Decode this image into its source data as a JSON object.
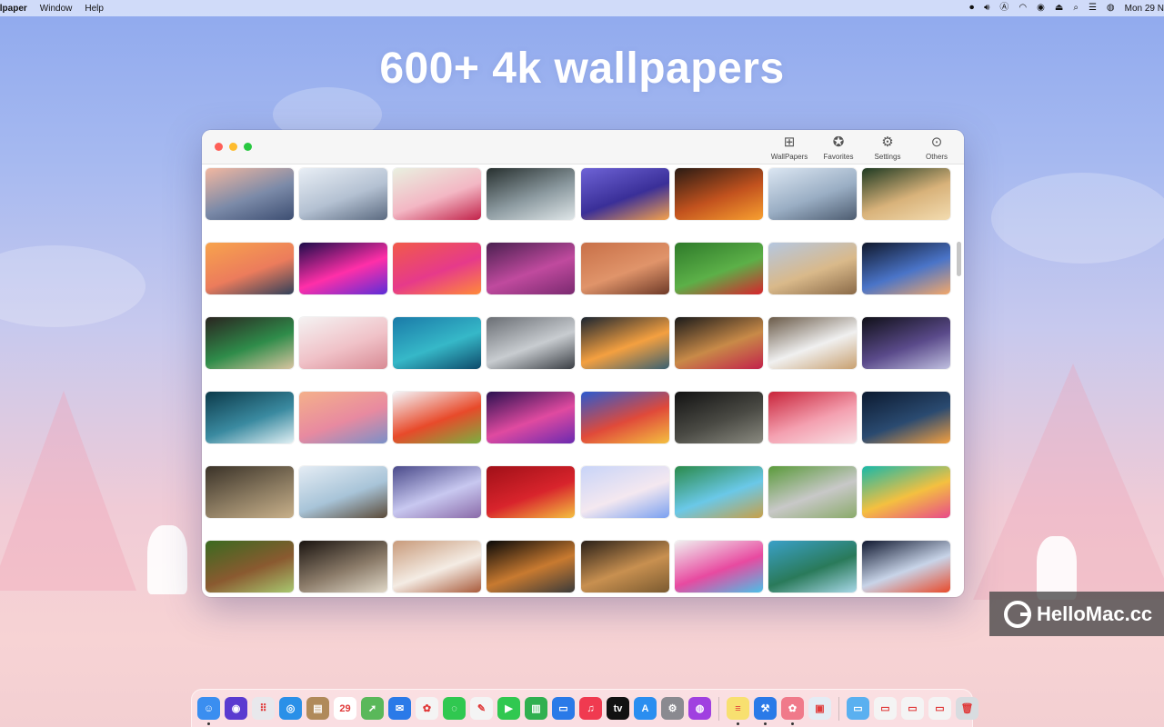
{
  "menubar": {
    "app_name": "llpaper",
    "items": [
      "Window",
      "Help"
    ],
    "clock": "Mon 29 N",
    "status_icons": [
      "record-icon",
      "volume-icon",
      "input-source-icon",
      "wifi-icon",
      "user-icon",
      "eject-icon",
      "spotlight-icon",
      "control-center-icon",
      "siri-icon"
    ]
  },
  "headline": "600+ 4k wallpapers",
  "window": {
    "toolbar": [
      {
        "name": "wallpapers",
        "label": "WallPapers",
        "icon": "grid-icon",
        "glyph": "⊞"
      },
      {
        "name": "favorites",
        "label": "Favorites",
        "icon": "star-icon",
        "glyph": "✪"
      },
      {
        "name": "settings",
        "label": "Settings",
        "icon": "gear-icon",
        "glyph": "⚙"
      },
      {
        "name": "others",
        "label": "Others",
        "icon": "ellipsis-icon",
        "glyph": "⊙"
      }
    ],
    "thumbnails": [
      {
        "name": "canyon-sunset",
        "colors": [
          "#f2b7a0",
          "#7b8aa8",
          "#3d4e72"
        ]
      },
      {
        "name": "snowy-mountain-climbers",
        "colors": [
          "#e8eef5",
          "#b4c1d2",
          "#5b6a80"
        ]
      },
      {
        "name": "raspberries-bowl",
        "colors": [
          "#e9f0e0",
          "#f3b7c4",
          "#c2224a"
        ]
      },
      {
        "name": "misty-forest-lake",
        "colors": [
          "#27302f",
          "#8c9aa0",
          "#dfe6e8"
        ]
      },
      {
        "name": "overwater-bungalows-dusk",
        "colors": [
          "#6e63d6",
          "#3a2f98",
          "#f6a24c"
        ]
      },
      {
        "name": "lava-waterfall",
        "colors": [
          "#2a1b14",
          "#c2521e",
          "#f8a030"
        ]
      },
      {
        "name": "car-snowy-road",
        "colors": [
          "#dbe6f2",
          "#9aaec4",
          "#4d5c70"
        ]
      },
      {
        "name": "golden-retriever",
        "colors": [
          "#1e3a22",
          "#d8b27a",
          "#f3dcb0"
        ]
      },
      {
        "name": "sunset-horizon",
        "colors": [
          "#f7a34d",
          "#ec7c5c",
          "#30405a"
        ]
      },
      {
        "name": "neon-pyramids",
        "colors": [
          "#1c0c4a",
          "#ff2fa8",
          "#5a2dd8"
        ]
      },
      {
        "name": "macos-big-sur",
        "colors": [
          "#f15a4a",
          "#e63a8a",
          "#ff8a3a"
        ]
      },
      {
        "name": "purple-blossoms",
        "colors": [
          "#4a2050",
          "#c04a9e",
          "#7a2a70"
        ]
      },
      {
        "name": "eggs-pattern",
        "colors": [
          "#c87048",
          "#e0946a",
          "#6e3a28"
        ]
      },
      {
        "name": "strawberries-leaves",
        "colors": [
          "#2e7a2a",
          "#5cb048",
          "#d8242c"
        ]
      },
      {
        "name": "desert-hills",
        "colors": [
          "#b5c7e0",
          "#d9b98a",
          "#8a6a48"
        ]
      },
      {
        "name": "lotus-flower",
        "colors": [
          "#10182c",
          "#4a74c8",
          "#f4a86a"
        ]
      },
      {
        "name": "coffee-cup",
        "colors": [
          "#2a2420",
          "#2f8c4a",
          "#d8c4a0"
        ]
      },
      {
        "name": "pink-coral",
        "colors": [
          "#f4f2f2",
          "#f0c2c8",
          "#d88a94"
        ]
      },
      {
        "name": "aerial-lagoon",
        "colors": [
          "#1a7aa8",
          "#36b8c8",
          "#0e4a6a"
        ]
      },
      {
        "name": "water-drops",
        "colors": [
          "#6a6e74",
          "#c8ccd0",
          "#3a3e44"
        ]
      },
      {
        "name": "train-light-trails",
        "colors": [
          "#1a2430",
          "#f4a040",
          "#3a6070"
        ]
      },
      {
        "name": "pancakes-berries",
        "colors": [
          "#1a1a1a",
          "#c88a48",
          "#c2224a"
        ]
      },
      {
        "name": "squirrel-snow",
        "colors": [
          "#6a5a48",
          "#f0f0f0",
          "#c8a070"
        ]
      },
      {
        "name": "galaxy-light",
        "colors": [
          "#101018",
          "#5a4a8a",
          "#c0c0e0"
        ]
      },
      {
        "name": "ocean-waves",
        "colors": [
          "#0c3a4a",
          "#3a8aa0",
          "#e0f0f4"
        ]
      },
      {
        "name": "cranes-sunset",
        "colors": [
          "#f4b08a",
          "#e88aa0",
          "#7a90c8"
        ]
      },
      {
        "name": "fruit-splash",
        "colors": [
          "#f4f6fa",
          "#e84a2a",
          "#7ab040"
        ]
      },
      {
        "name": "pink-nebula",
        "colors": [
          "#2a1050",
          "#e04aa0",
          "#6a2ab0"
        ]
      },
      {
        "name": "abstract-paint",
        "colors": [
          "#2a5ad0",
          "#e04a3a",
          "#f4c040"
        ]
      },
      {
        "name": "rifle-gear",
        "colors": [
          "#121212",
          "#4a4a44",
          "#8a8a80"
        ]
      },
      {
        "name": "valentine-cupcakes",
        "colors": [
          "#c8243a",
          "#f4a0b0",
          "#f8e0e4"
        ]
      },
      {
        "name": "night-sky-earth",
        "colors": [
          "#0c1a30",
          "#2a4a70",
          "#f4a040"
        ]
      },
      {
        "name": "owl-portrait",
        "colors": [
          "#3a3228",
          "#8a7a60",
          "#c8b08a"
        ]
      },
      {
        "name": "bear-statue-sea",
        "colors": [
          "#e4ecf4",
          "#a8c4d8",
          "#5a4a38"
        ]
      },
      {
        "name": "anime-girls",
        "colors": [
          "#4a4a8a",
          "#c8c8f0",
          "#8a6aa8"
        ]
      },
      {
        "name": "chinese-new-year",
        "colors": [
          "#a01018",
          "#d8242c",
          "#f4c040"
        ]
      },
      {
        "name": "minimal-sunrise",
        "colors": [
          "#c8d4f8",
          "#f4e8f0",
          "#7aa0f0"
        ]
      },
      {
        "name": "green-valley-painting",
        "colors": [
          "#2a8a4a",
          "#6ac8e8",
          "#c8a048"
        ]
      },
      {
        "name": "kitten-grass",
        "colors": [
          "#5a9a3a",
          "#c8c8c8",
          "#8aaa6a"
        ]
      },
      {
        "name": "colorful-layers",
        "colors": [
          "#18b8a8",
          "#f4c040",
          "#e84a8a"
        ]
      },
      {
        "name": "squirrel-moss",
        "colors": [
          "#3a6a20",
          "#8a5a30",
          "#a8c870"
        ]
      },
      {
        "name": "dark-interior",
        "colors": [
          "#1a1410",
          "#8a7a68",
          "#e0d8c8"
        ]
      },
      {
        "name": "dove-autumn",
        "colors": [
          "#c89a7a",
          "#f4ece4",
          "#a85a3a"
        ]
      },
      {
        "name": "sports-car-dark",
        "colors": [
          "#080808",
          "#c87a30",
          "#3a3a3a"
        ]
      },
      {
        "name": "lion-portrait",
        "colors": [
          "#2a2018",
          "#c89050",
          "#7a5a30"
        ]
      },
      {
        "name": "birthday-candles",
        "colors": [
          "#f0f0f0",
          "#e84aa0",
          "#4ac0e8"
        ]
      },
      {
        "name": "karst-bay",
        "colors": [
          "#3aa0c8",
          "#2a7a5a",
          "#a8d8e8"
        ]
      },
      {
        "name": "wolf-fantasy",
        "colors": [
          "#101830",
          "#c8d4e8",
          "#e84a2a"
        ]
      }
    ]
  },
  "watermark": "HelloMac.cc",
  "dock": {
    "items": [
      {
        "name": "finder",
        "color": "#3a8ef0",
        "glyph": "☺",
        "running": true
      },
      {
        "name": "siri",
        "color": "#5a3ad0",
        "glyph": "◉",
        "running": false
      },
      {
        "name": "launchpad",
        "color": "#e8e8ec",
        "glyph": "⠿",
        "running": false
      },
      {
        "name": "safari",
        "color": "#2a90e8",
        "glyph": "◎",
        "running": false
      },
      {
        "name": "contacts",
        "color": "#b08a5a",
        "glyph": "▤",
        "running": false
      },
      {
        "name": "calendar",
        "color": "#ffffff",
        "glyph": "29",
        "running": false
      },
      {
        "name": "maps",
        "color": "#5ab85a",
        "glyph": "➚",
        "running": false
      },
      {
        "name": "mail",
        "color": "#2a7ae8",
        "glyph": "✉",
        "running": false
      },
      {
        "name": "photos",
        "color": "#f4f4f4",
        "glyph": "✿",
        "running": false
      },
      {
        "name": "messages",
        "color": "#30c850",
        "glyph": "◌",
        "running": false
      },
      {
        "name": "freeform",
        "color": "#f4f4f4",
        "glyph": "✎",
        "running": false
      },
      {
        "name": "facetime",
        "color": "#30c850",
        "glyph": "▶",
        "running": false
      },
      {
        "name": "numbers",
        "color": "#30b050",
        "glyph": "▥",
        "running": false
      },
      {
        "name": "keynote",
        "color": "#2a7ae8",
        "glyph": "▭",
        "running": false
      },
      {
        "name": "music",
        "color": "#f03a50",
        "glyph": "♫",
        "running": false
      },
      {
        "name": "tv",
        "color": "#111111",
        "glyph": "tv",
        "running": false
      },
      {
        "name": "app-store",
        "color": "#2a8ef0",
        "glyph": "A",
        "running": false
      },
      {
        "name": "system-preferences",
        "color": "#8a8a90",
        "glyph": "⚙",
        "running": false
      },
      {
        "name": "podcasts",
        "color": "#a040e0",
        "glyph": "◍",
        "running": false
      },
      {
        "name": "notes",
        "color": "#f8e070",
        "glyph": "≡",
        "running": true
      },
      {
        "name": "xcode",
        "color": "#2a7ae8",
        "glyph": "⚒",
        "running": true
      },
      {
        "name": "wallpaper-app",
        "color": "#f07a8a",
        "glyph": "✿",
        "running": true
      },
      {
        "name": "preview",
        "color": "#e4ecf4",
        "glyph": "▣",
        "running": false
      },
      {
        "name": "folder",
        "color": "#5ab0f0",
        "glyph": "▭",
        "running": false
      },
      {
        "name": "window-1",
        "color": "#f4f4f4",
        "glyph": "▭",
        "running": false
      },
      {
        "name": "window-2",
        "color": "#f4f4f4",
        "glyph": "▭",
        "running": false
      },
      {
        "name": "window-3",
        "color": "#f4f4f4",
        "glyph": "▭",
        "running": false
      },
      {
        "name": "trash",
        "color": "#d8dce0",
        "glyph": "🗑",
        "running": false
      }
    ]
  }
}
